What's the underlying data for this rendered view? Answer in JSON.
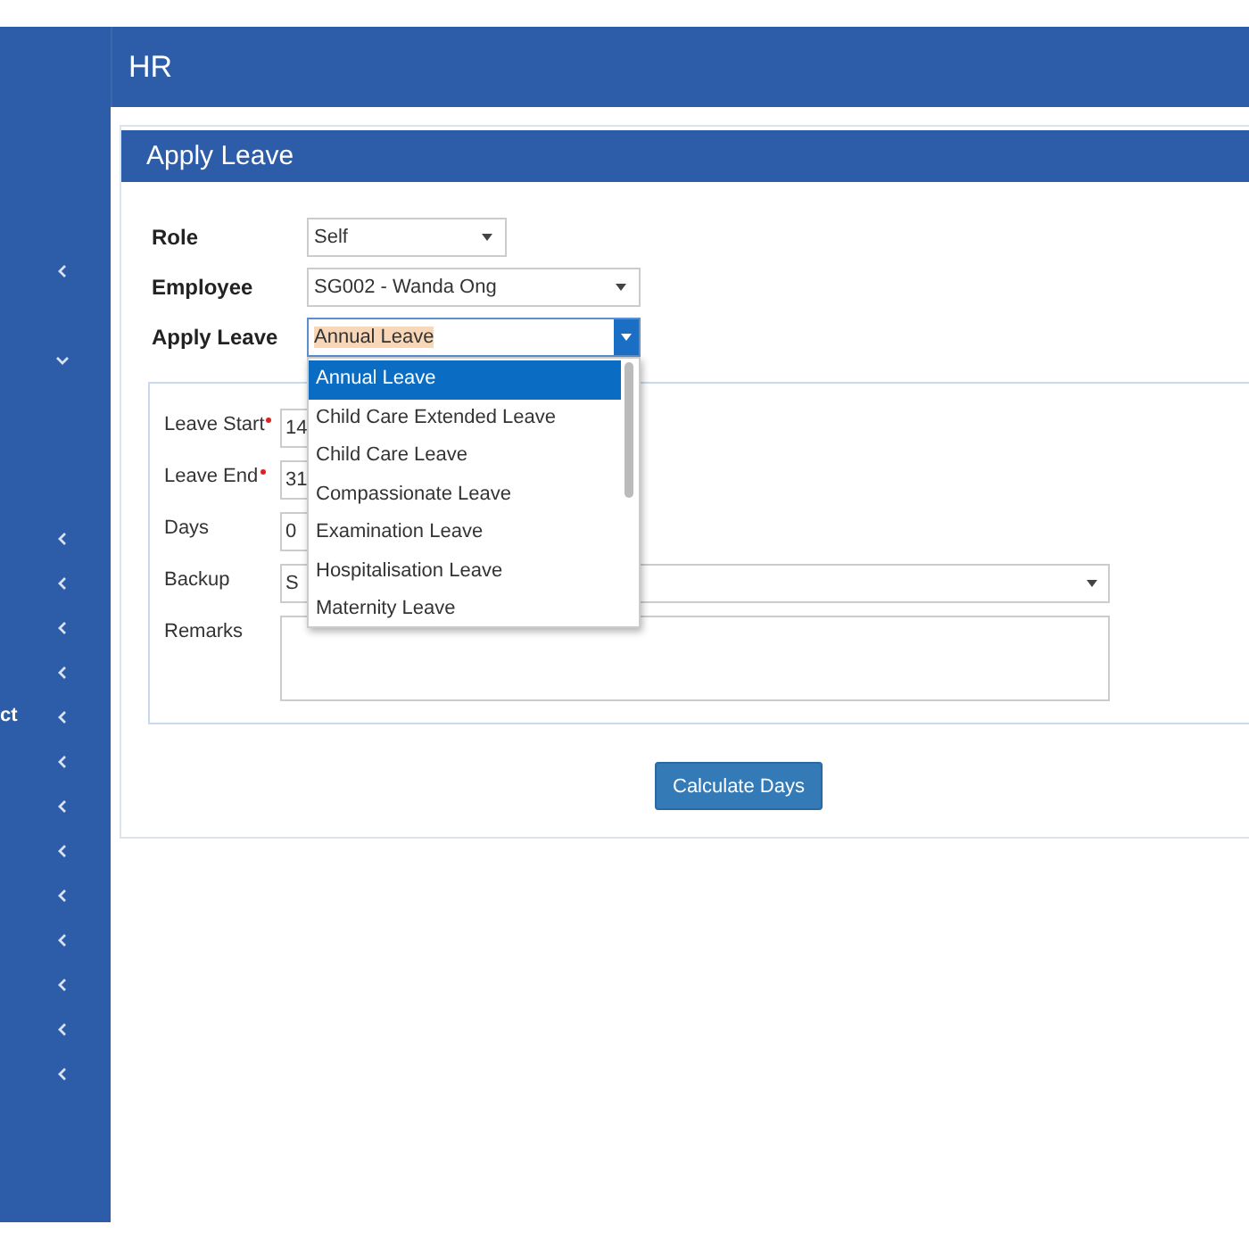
{
  "sidebar": {
    "items": [
      {
        "expanded": false
      },
      {
        "expanded": true
      },
      {
        "expanded": false
      },
      {
        "expanded": false
      },
      {
        "expanded": false
      },
      {
        "expanded": false
      },
      {
        "label": "ct",
        "expanded": false
      },
      {
        "expanded": false
      },
      {
        "expanded": false
      },
      {
        "expanded": false
      },
      {
        "expanded": false
      },
      {
        "expanded": false
      },
      {
        "expanded": false
      },
      {
        "expanded": false
      },
      {
        "expanded": false
      }
    ]
  },
  "header": {
    "title": "HR"
  },
  "card": {
    "title": "Apply Leave",
    "fields": [
      {
        "label": "Role",
        "value": "Self",
        "kind": "select"
      },
      {
        "label": "Employee",
        "value": "SG002 - Wanda Ong",
        "kind": "select"
      },
      {
        "label": "Apply Leave",
        "value": "Annual Leave",
        "kind": "combo",
        "expanded": true,
        "options": [
          {
            "label": "Annual Leave",
            "selected": true
          },
          {
            "label": "Child Care Extended Leave",
            "selected": false
          },
          {
            "label": "Child Care Leave",
            "selected": false
          },
          {
            "label": "Compassionate Leave",
            "selected": false
          },
          {
            "label": "Examination Leave",
            "selected": false
          },
          {
            "label": "Hospitalisation Leave",
            "selected": false
          },
          {
            "label": "Maternity Leave",
            "selected": false
          }
        ]
      }
    ],
    "details": [
      {
        "label": "Leave Start",
        "required": true,
        "value": "14",
        "kind": "input"
      },
      {
        "label": "Leave End",
        "required": true,
        "value": "31",
        "kind": "input"
      },
      {
        "label": "Days",
        "required": false,
        "value": "0",
        "kind": "input"
      },
      {
        "label": "Backup",
        "required": false,
        "value": "S",
        "kind": "select"
      },
      {
        "label": "Remarks",
        "required": false,
        "kind": "textarea"
      }
    ],
    "button": "Calculate Days"
  }
}
